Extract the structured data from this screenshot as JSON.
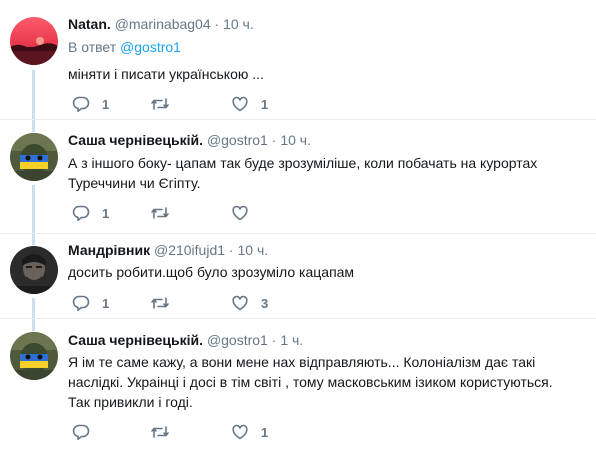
{
  "tweets": [
    {
      "name": "Natan.",
      "handle": "@marinabag04",
      "dot": "·",
      "time": "10 ч.",
      "reply_prefix": "В ответ",
      "reply_mention": "@gostro1",
      "text": "міняти і писати українською ...",
      "replies": "1",
      "retweets": "",
      "likes": "1",
      "avatar": "sunset-avatar"
    },
    {
      "name": "Саша чернівецькій.",
      "handle": "@gostro1",
      "dot": "·",
      "time": "10 ч.",
      "text": "А з іншого боку- цапам так буде зрозуміліше, коли побачать на курортах Туреччини чи Єгіпту.",
      "replies": "1",
      "retweets": "",
      "likes": "",
      "avatar": "soldier-flag-avatar"
    },
    {
      "name": "Мандрівник",
      "handle": "@210ifujd1",
      "dot": "·",
      "time": "10 ч.",
      "text": "досить робити.щоб було зрозуміло кацапам",
      "replies": "1",
      "retweets": "",
      "likes": "3",
      "avatar": "portrait-avatar"
    },
    {
      "name": "Саша чернівецькій.",
      "handle": "@gostro1",
      "dot": "·",
      "time": "1 ч.",
      "text": "Я ім те саме кажу, а вони мене нах відправляють... Колоніалізм дає такі наслідкі. Украінці і досі в тім світі , тому масковським ізиком користуються. Так привикли і годі.",
      "replies": "",
      "retweets": "",
      "likes": "1",
      "avatar": "soldier-flag-avatar"
    }
  ],
  "colors": {
    "text": "#14171a",
    "muted": "#657786",
    "link": "#1da1f2",
    "thread_line": "#cce0ee",
    "divider": "#e6ecf0"
  }
}
